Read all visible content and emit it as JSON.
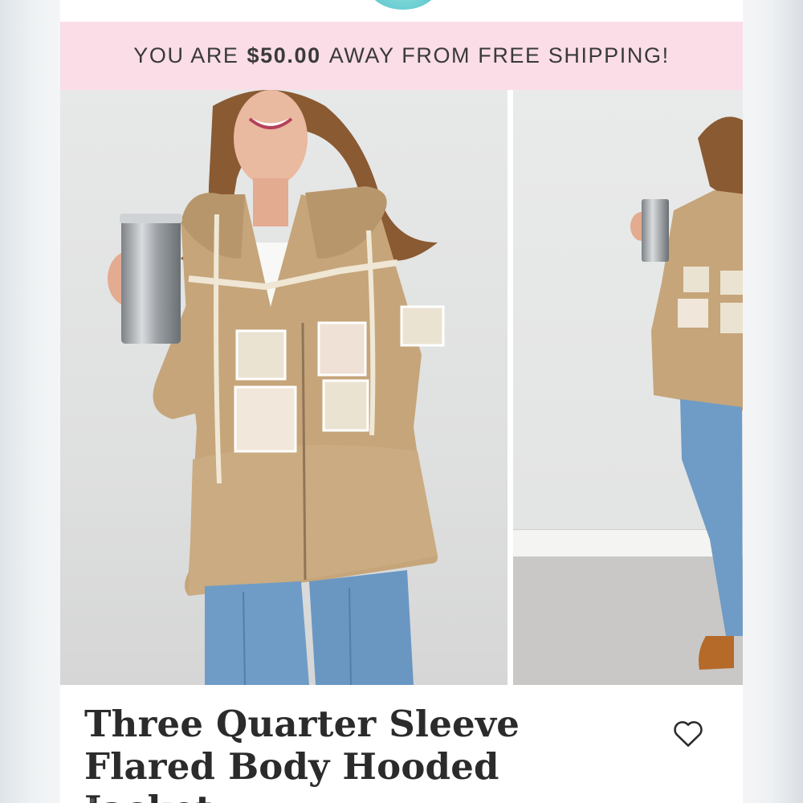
{
  "promo_banner": {
    "prefix": "YOU ARE",
    "amount": "$50.00",
    "suffix": "AWAY FROM FREE SHIPPING!"
  },
  "gallery": {
    "images": [
      {
        "description_icon": "product-photo-front"
      },
      {
        "description_icon": "product-photo-side"
      }
    ]
  },
  "product": {
    "title": "Three Quarter Sleeve Flared Body Hooded Jacket"
  },
  "icons": {
    "wishlist": "heart-outline-icon"
  },
  "colors": {
    "promo_bg": "#fadde7",
    "jacket_tan": "#c9a87a",
    "denim": "#6f9cc6"
  }
}
